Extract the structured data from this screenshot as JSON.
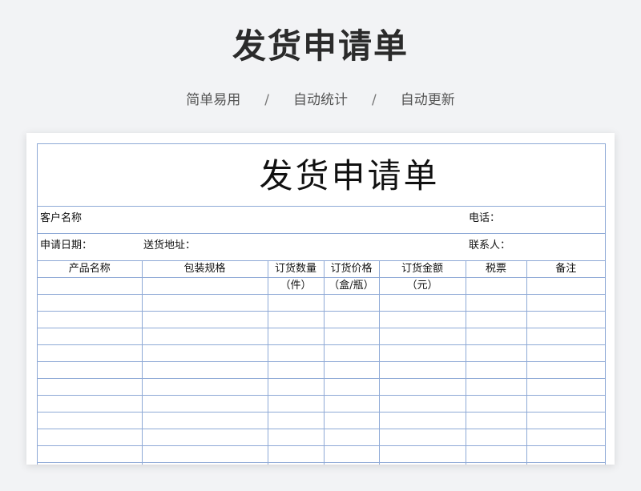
{
  "header": {
    "title": "发货申请单",
    "subtitle_items": [
      "简单易用",
      "自动统计",
      "自动更新"
    ],
    "separator": "/"
  },
  "form": {
    "title": "发货申请单",
    "customer_label": "客户名称",
    "phone_label": "电话：",
    "apply_date_label": "申请日期：",
    "delivery_address_label": "送货地址：",
    "contact_label": "联系人：",
    "columns": [
      {
        "line1": "产品名称",
        "line2": ""
      },
      {
        "line1": "包装规格",
        "line2": ""
      },
      {
        "line1": "订货数量",
        "line2": "（件）"
      },
      {
        "line1": "订货价格",
        "line2": "（盒/瓶）"
      },
      {
        "line1": "订货金额",
        "line2": "（元）"
      },
      {
        "line1": "税票",
        "line2": ""
      },
      {
        "line1": "备注",
        "line2": ""
      }
    ]
  }
}
